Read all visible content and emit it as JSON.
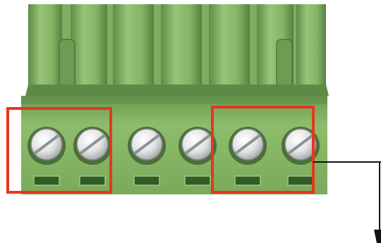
{
  "photo": {
    "subject": "green-terminal-block-connector",
    "terminal_count": 6,
    "screw_icon": "slotted-screw-icon"
  },
  "highlights": [
    {
      "label": "",
      "covers_terminals": [
        1,
        2
      ]
    },
    {
      "label": "",
      "covers_terminals": [
        5,
        6
      ]
    }
  ],
  "colors": {
    "connector_green": "#7fae60",
    "connector_dark": "#4f7a3c",
    "connector_light": "#a6cf86",
    "screw_metal": "#e4e6e6",
    "highlight_box": "#e8361c",
    "callout_line": "#111111",
    "background": "#ffffff"
  }
}
